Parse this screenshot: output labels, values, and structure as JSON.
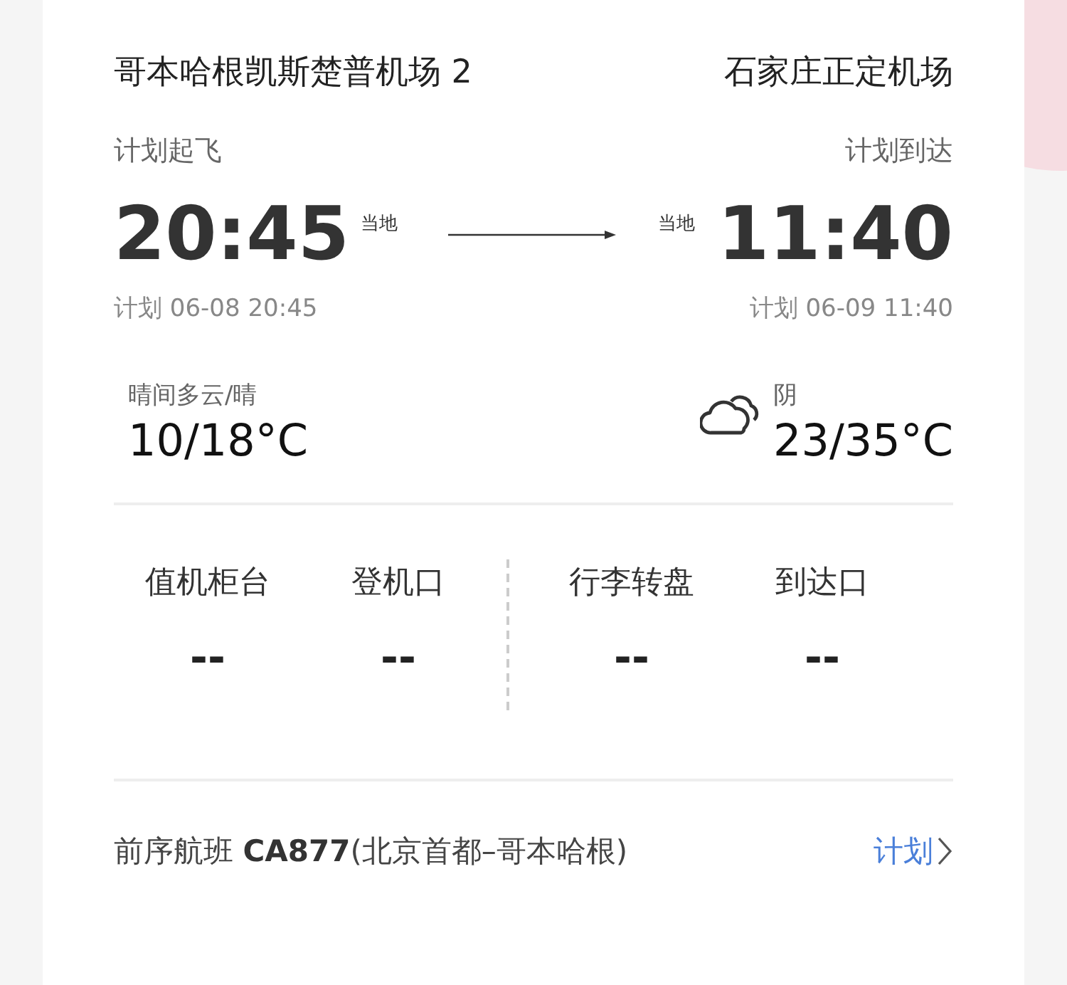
{
  "departure": {
    "airport": "哥本哈根凯斯楚普机场 2",
    "label": "计划起飞",
    "time": "20:45",
    "zone": "当地",
    "planned": "计划 06-08 20:45",
    "weather": {
      "condition": "晴间多云/晴",
      "temp": "10/18°C"
    }
  },
  "arrival": {
    "airport": "石家庄正定机场",
    "label": "计划到达",
    "time": "11:40",
    "zone": "当地",
    "planned": "计划 06-09 11:40",
    "weather": {
      "condition": "阴",
      "temp": "23/35°C"
    }
  },
  "info": [
    {
      "label": "值机柜台",
      "value": "--"
    },
    {
      "label": "登机口",
      "value": "--"
    },
    {
      "label": "行李转盘",
      "value": "--"
    },
    {
      "label": "到达口",
      "value": "--"
    }
  ],
  "previous_flight": {
    "text": "前序航班 **CA877**(北京首都–哥本哈根)",
    "status": "计划"
  }
}
